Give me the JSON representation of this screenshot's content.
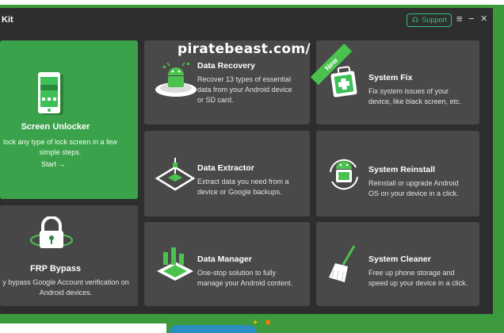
{
  "window": {
    "title": "Kit",
    "support_label": "Support",
    "menu_glyph": "≡",
    "minimize_glyph": "−",
    "close_glyph": "✕"
  },
  "watermark": "piratebeast.com/",
  "ribbon": "New",
  "left_cards": {
    "screen_unlocker": {
      "title": "Screen Unlocker",
      "desc_line1": "lock any type of lock screen in a few",
      "desc_line2": "simple steps.",
      "start_label": "Start",
      "start_arrow": "→",
      "icon": "phone-lock-icon"
    },
    "frp_bypass": {
      "title": "FRP Bypass",
      "desc_line1": "y bypass Google Account verification on",
      "desc_line2": "Android devices.",
      "icon": "padlock-icon"
    }
  },
  "cards": [
    {
      "title": "Data Recovery",
      "desc": [
        "Recover 13 types of essential",
        "data from your Android device",
        "or SD card."
      ],
      "icon": "android-recovery-icon"
    },
    {
      "title": "System Fix",
      "desc": [
        "Fix system issues of your",
        "device, like black screen, etc."
      ],
      "icon": "first-aid-kit-icon"
    },
    {
      "title": "Data Extractor",
      "desc": [
        "Extract data you need from a",
        "device or Google backups."
      ],
      "icon": "data-extractor-icon"
    },
    {
      "title": "System Reinstall",
      "desc": [
        "Reinstall or upgrade Android",
        "OS on your device in a click."
      ],
      "icon": "android-reinstall-icon"
    },
    {
      "title": "Data Manager",
      "desc": [
        "One-stop solution to fully",
        "manage your Android content."
      ],
      "icon": "data-manager-icon"
    },
    {
      "title": "System Cleaner",
      "desc": [
        "Free up phone storage and",
        "speed up your device in a click."
      ],
      "icon": "broom-icon"
    }
  ],
  "colors": {
    "accent": "#3aa24a",
    "support": "#2ec47a",
    "card": "#494949",
    "window": "#2e2e2e"
  }
}
